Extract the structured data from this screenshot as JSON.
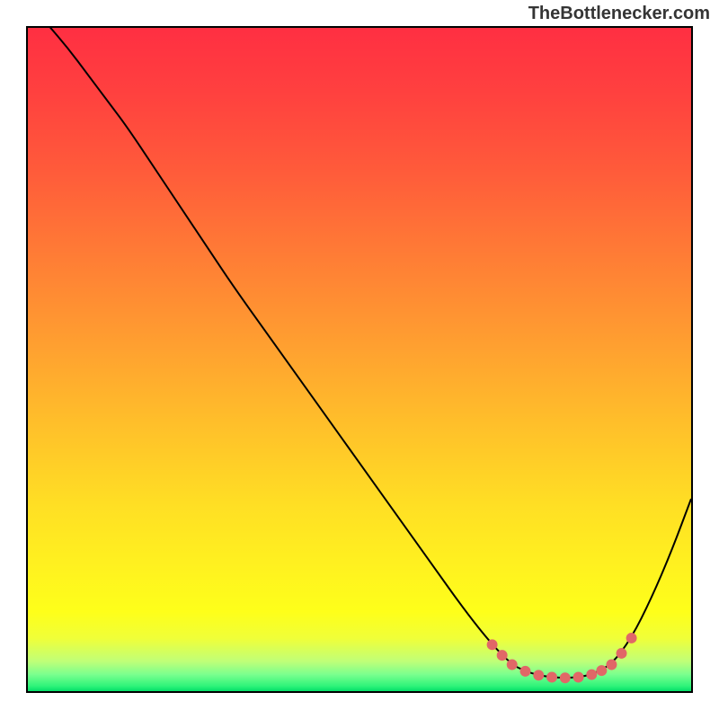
{
  "attribution": "TheBottlenecker.com",
  "chart_data": {
    "type": "line",
    "title": "",
    "xlabel": "",
    "ylabel": "",
    "xlim": [
      0,
      100
    ],
    "ylim": [
      0,
      100
    ],
    "grid": false,
    "background_gradient_stops": [
      {
        "offset": 0.0,
        "color": "#ff2f42"
      },
      {
        "offset": 0.1,
        "color": "#ff413f"
      },
      {
        "offset": 0.22,
        "color": "#ff5c3a"
      },
      {
        "offset": 0.35,
        "color": "#ff7e35"
      },
      {
        "offset": 0.48,
        "color": "#ffa030"
      },
      {
        "offset": 0.6,
        "color": "#ffc02a"
      },
      {
        "offset": 0.72,
        "color": "#ffdf24"
      },
      {
        "offset": 0.82,
        "color": "#fff31f"
      },
      {
        "offset": 0.88,
        "color": "#feff1a"
      },
      {
        "offset": 0.92,
        "color": "#f0ff38"
      },
      {
        "offset": 0.955,
        "color": "#c0ff78"
      },
      {
        "offset": 0.975,
        "color": "#7aff8e"
      },
      {
        "offset": 0.992,
        "color": "#30f47a"
      },
      {
        "offset": 1.0,
        "color": "#04df68"
      }
    ],
    "curve_color": "#000000",
    "curve_width": 2,
    "marker_color": "#e16767",
    "marker_radius": 6,
    "series": [
      {
        "name": "bottleneck-curve",
        "x": [
          0,
          3,
          6,
          9,
          12,
          15,
          19,
          23,
          27,
          31,
          36,
          41,
          46,
          51,
          56,
          61,
          66,
          70,
          73,
          75,
          77,
          79,
          81,
          83,
          85,
          88,
          91,
          94,
          97,
          100
        ],
        "y": [
          104,
          100.5,
          97,
          93,
          89,
          85,
          79,
          73,
          67,
          61,
          54,
          47,
          40,
          33,
          26,
          19,
          12,
          7,
          4,
          3,
          2.4,
          2.1,
          2,
          2.1,
          2.5,
          4,
          8,
          14,
          21,
          29
        ]
      }
    ],
    "markers": [
      {
        "x": 70,
        "y": 7
      },
      {
        "x": 71.5,
        "y": 5.4
      },
      {
        "x": 73,
        "y": 4
      },
      {
        "x": 75,
        "y": 3
      },
      {
        "x": 77,
        "y": 2.4
      },
      {
        "x": 79,
        "y": 2.1
      },
      {
        "x": 81,
        "y": 2
      },
      {
        "x": 83,
        "y": 2.1
      },
      {
        "x": 85,
        "y": 2.5
      },
      {
        "x": 86.5,
        "y": 3.1
      },
      {
        "x": 88,
        "y": 4
      },
      {
        "x": 89.5,
        "y": 5.7
      },
      {
        "x": 91,
        "y": 8
      }
    ]
  }
}
